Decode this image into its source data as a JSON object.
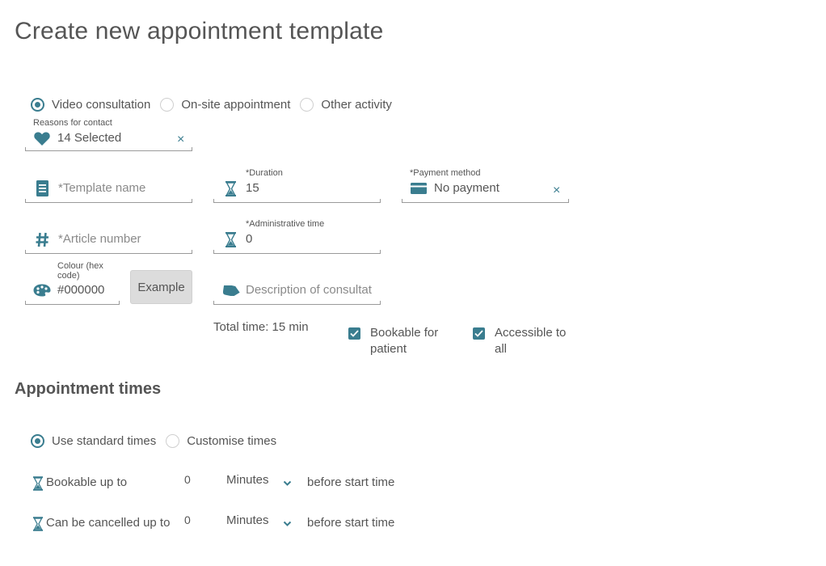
{
  "page": {
    "title": "Create new appointment template",
    "section_appointment_times": "Appointment times"
  },
  "appointment_type": {
    "options": [
      {
        "label": "Video consultation",
        "checked": true
      },
      {
        "label": "On-site appointment",
        "checked": false
      },
      {
        "label": "Other activity",
        "checked": false
      }
    ]
  },
  "reasons": {
    "label": "Reasons for contact",
    "value": "14 Selected",
    "icon": "heart-icon",
    "clear": "×"
  },
  "template_name": {
    "placeholder": "*Template name",
    "value": "",
    "icon": "document-icon"
  },
  "duration": {
    "label": "*Duration",
    "value": "15",
    "icon": "hourglass-icon"
  },
  "payment": {
    "label": "*Payment method",
    "value": "No payment",
    "icon": "credit-card-icon",
    "clear": "×"
  },
  "article_number": {
    "placeholder": "*Article number",
    "value": "",
    "icon": "hash-icon"
  },
  "admin_time": {
    "label": "*Administrative time",
    "value": "0",
    "icon": "hourglass-icon"
  },
  "colour": {
    "label_line1": "Colour (hex",
    "label_line2": "code)",
    "value": "#000000",
    "icon": "palette-icon",
    "example_label": "Example"
  },
  "description": {
    "placeholder": "Description of consultat",
    "icon": "tag-icon"
  },
  "total_time": "Total time: 15 min",
  "checkboxes": [
    {
      "line1": "Bookable for",
      "line2": "patient",
      "checked": true
    },
    {
      "line1": "Accessible to",
      "line2": "all",
      "checked": true
    }
  ],
  "times_mode": {
    "options": [
      {
        "label": "Use standard times",
        "checked": true
      },
      {
        "label": "Customise times",
        "checked": false
      }
    ]
  },
  "time_rows": [
    {
      "label": "Bookable up to",
      "value": "0",
      "unit": "Minutes",
      "suffix": "before start time"
    },
    {
      "label": "Can be cancelled up to",
      "value": "0",
      "unit": "Minutes",
      "suffix": "before start time"
    }
  ],
  "colors": {
    "accent": "#3a7d8f",
    "text": "#555555",
    "placeholder": "#8a8a8a",
    "button_bg": "#dcdcdc"
  }
}
